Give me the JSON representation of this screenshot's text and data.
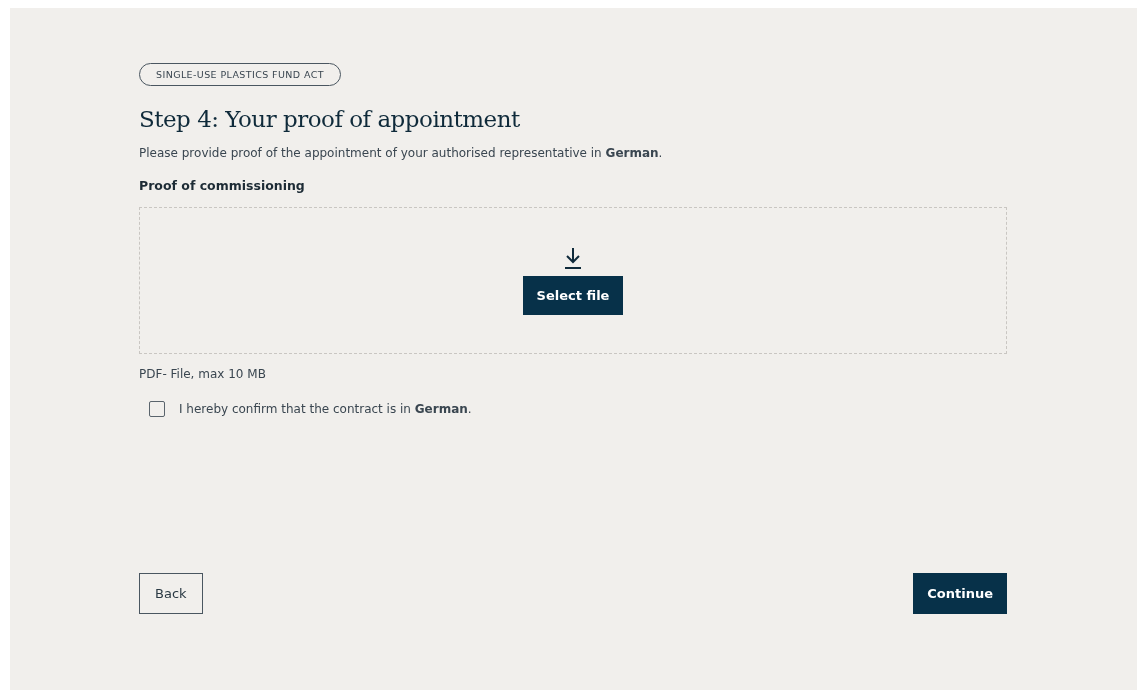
{
  "badge": "SINGLE-USE PLASTICS FUND ACT",
  "title": "Step 4: Your proof of appointment",
  "intro": "Please provide proof of the appointment of your authorised representative in **German**.",
  "upload": {
    "label": "Proof of commissioning",
    "button": "Select file",
    "hint": "PDF- File, max 10 MB"
  },
  "confirm": {
    "label": "I hereby confirm that the contract is in **German**.",
    "checked": false
  },
  "buttons": [
    {
      "kind": "secondary",
      "label": "Back"
    },
    {
      "kind": "primary",
      "label": "Continue"
    }
  ]
}
